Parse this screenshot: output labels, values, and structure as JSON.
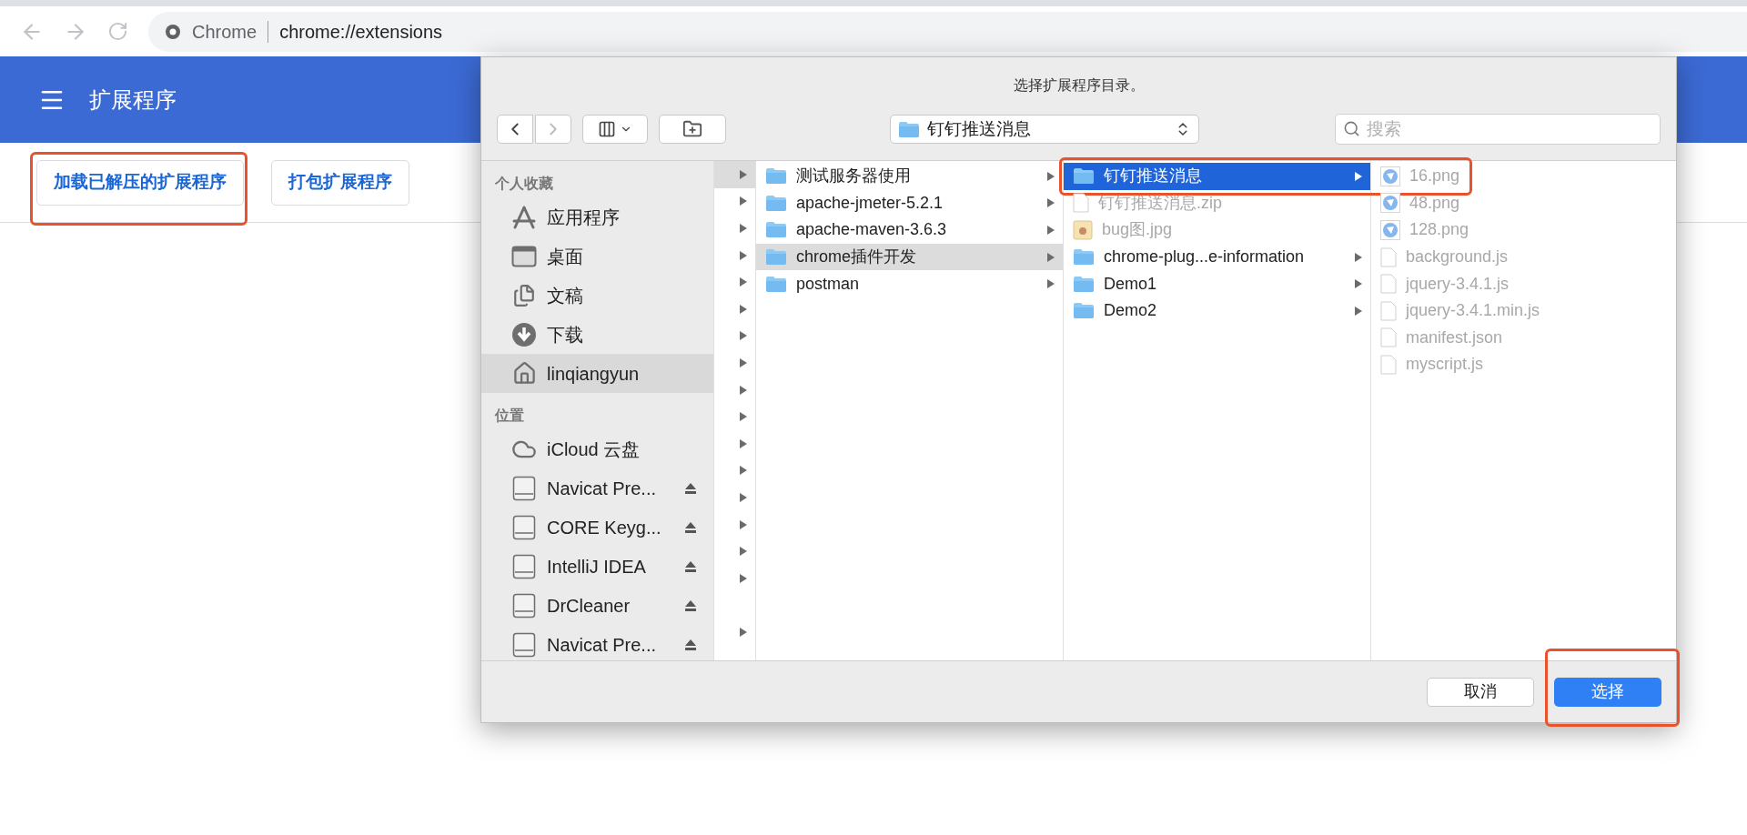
{
  "browser": {
    "site_label": "Chrome",
    "url": "chrome://extensions"
  },
  "header": {
    "title": "扩展程序"
  },
  "toolbar_buttons": [
    {
      "label": "加载已解压的扩展程序",
      "highlighted": true
    },
    {
      "label": "打包扩展程序",
      "highlighted": false
    }
  ],
  "dialog": {
    "title": "选择扩展程序目录。",
    "path_popup": "钉钉推送消息",
    "search": {
      "placeholder": "搜索"
    },
    "sidebar": [
      {
        "heading": "个人收藏",
        "items": [
          {
            "label": "应用程序",
            "kind": "apps",
            "selected": false,
            "eject": false
          },
          {
            "label": "桌面",
            "kind": "desktop",
            "selected": false,
            "eject": false
          },
          {
            "label": "文稿",
            "kind": "documents",
            "selected": false,
            "eject": false
          },
          {
            "label": "下载",
            "kind": "downloads",
            "selected": false,
            "eject": false
          },
          {
            "label": "linqiangyun",
            "kind": "home",
            "selected": true,
            "eject": false
          }
        ]
      },
      {
        "heading": "位置",
        "items": [
          {
            "label": "iCloud 云盘",
            "kind": "cloud",
            "selected": false,
            "eject": false
          },
          {
            "label": "Navicat Pre...",
            "kind": "disk",
            "selected": false,
            "eject": true
          },
          {
            "label": "CORE Keyg...",
            "kind": "disk",
            "selected": false,
            "eject": true
          },
          {
            "label": "IntelliJ IDEA",
            "kind": "disk",
            "selected": false,
            "eject": true
          },
          {
            "label": "DrCleaner",
            "kind": "disk",
            "selected": false,
            "eject": true
          },
          {
            "label": "Navicat Pre...",
            "kind": "disk",
            "selected": false,
            "eject": true
          }
        ]
      }
    ],
    "column_1": [
      {
        "selected": true,
        "arrow": true
      },
      {
        "selected": false,
        "arrow": true
      },
      {
        "selected": false,
        "arrow": true
      },
      {
        "selected": false,
        "arrow": true
      },
      {
        "selected": false,
        "arrow": true
      },
      {
        "selected": false,
        "arrow": true
      },
      {
        "selected": false,
        "arrow": true
      },
      {
        "selected": false,
        "arrow": true
      },
      {
        "selected": false,
        "arrow": true
      },
      {
        "selected": false,
        "arrow": true
      },
      {
        "selected": false,
        "arrow": true
      },
      {
        "selected": false,
        "arrow": true
      },
      {
        "selected": false,
        "arrow": true
      },
      {
        "selected": false,
        "arrow": true
      },
      {
        "selected": false,
        "arrow": true
      },
      {
        "selected": false,
        "arrow": true
      },
      {
        "selected": false,
        "arrow": false
      },
      {
        "selected": false,
        "arrow": true
      }
    ],
    "columns": [
      [
        {
          "label": "测试服务器使用",
          "kind": "folder",
          "selected": false,
          "enabled": true,
          "arrow": true,
          "highlighted": false
        },
        {
          "label": "apache-jmeter-5.2.1",
          "kind": "folder",
          "selected": false,
          "enabled": true,
          "arrow": true,
          "highlighted": false
        },
        {
          "label": "apache-maven-3.6.3",
          "kind": "folder",
          "selected": false,
          "enabled": true,
          "arrow": true,
          "highlighted": false
        },
        {
          "label": "chrome插件开发",
          "kind": "folder",
          "selected": true,
          "enabled": true,
          "arrow": true,
          "highlighted": false
        },
        {
          "label": "postman",
          "kind": "folder",
          "selected": false,
          "enabled": true,
          "arrow": true,
          "highlighted": false
        }
      ],
      [
        {
          "label": "钉钉推送消息",
          "kind": "folder",
          "selected": true,
          "enabled": true,
          "arrow": true,
          "highlighted": true
        },
        {
          "label": "钉钉推送消息.zip",
          "kind": "file",
          "selected": false,
          "enabled": false,
          "arrow": false,
          "highlighted": false
        },
        {
          "label": "bug图.jpg",
          "kind": "image",
          "selected": false,
          "enabled": false,
          "arrow": false,
          "highlighted": false
        },
        {
          "label": "chrome-plug...e-information",
          "kind": "folder",
          "selected": false,
          "enabled": true,
          "arrow": true,
          "highlighted": false
        },
        {
          "label": "Demo1",
          "kind": "folder",
          "selected": false,
          "enabled": true,
          "arrow": true,
          "highlighted": false
        },
        {
          "label": "Demo2",
          "kind": "folder",
          "selected": false,
          "enabled": true,
          "arrow": true,
          "highlighted": false
        }
      ],
      [
        {
          "label": "16.png",
          "kind": "png",
          "selected": false,
          "enabled": false,
          "arrow": false,
          "highlighted": false
        },
        {
          "label": "48.png",
          "kind": "png",
          "selected": false,
          "enabled": false,
          "arrow": false,
          "highlighted": false
        },
        {
          "label": "128.png",
          "kind": "png",
          "selected": false,
          "enabled": false,
          "arrow": false,
          "highlighted": false
        },
        {
          "label": "background.js",
          "kind": "file",
          "selected": false,
          "enabled": false,
          "arrow": false,
          "highlighted": false
        },
        {
          "label": "jquery-3.4.1.js",
          "kind": "file",
          "selected": false,
          "enabled": false,
          "arrow": false,
          "highlighted": false
        },
        {
          "label": "jquery-3.4.1.min.js",
          "kind": "file",
          "selected": false,
          "enabled": false,
          "arrow": false,
          "highlighted": false
        },
        {
          "label": "manifest.json",
          "kind": "file",
          "selected": false,
          "enabled": false,
          "arrow": false,
          "highlighted": false
        },
        {
          "label": "myscript.js",
          "kind": "file",
          "selected": false,
          "enabled": false,
          "arrow": false,
          "highlighted": false
        }
      ]
    ],
    "buttons": [
      {
        "label": "取消",
        "kind": "cancel",
        "highlighted": false
      },
      {
        "label": "选择",
        "kind": "default",
        "highlighted": true
      }
    ]
  }
}
